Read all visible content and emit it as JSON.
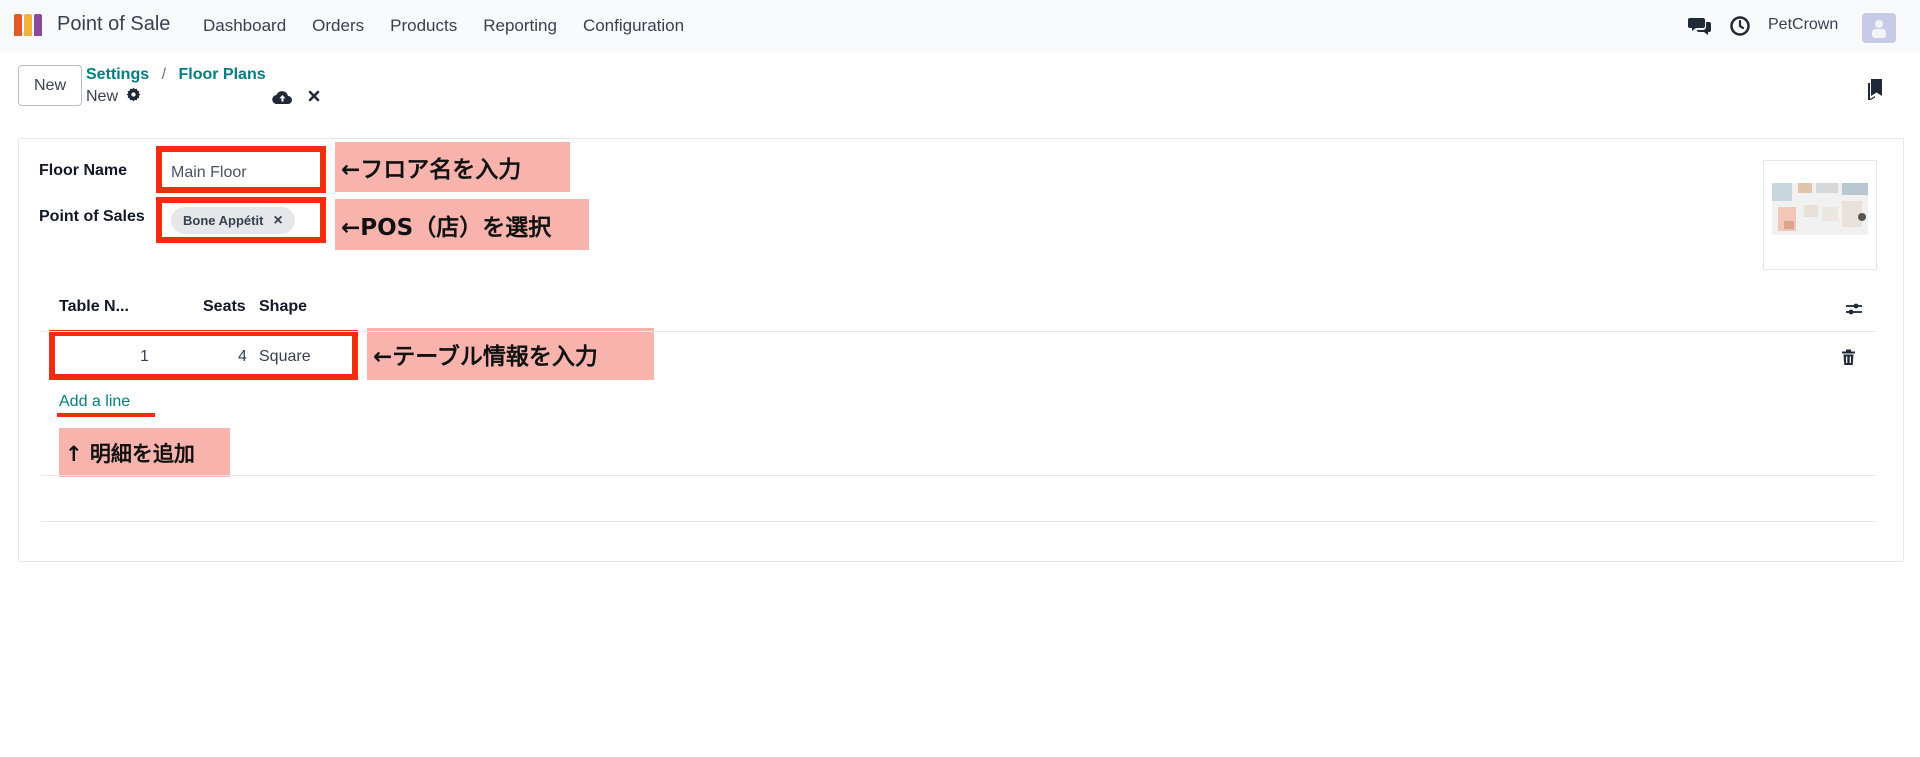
{
  "app": {
    "name": "Point of Sale",
    "logo_colors": [
      "#e05b2a",
      "#f2b23c",
      "#8c4a9c"
    ]
  },
  "navbar": {
    "menu": [
      "Dashboard",
      "Orders",
      "Products",
      "Reporting",
      "Configuration"
    ],
    "icons": [
      "chat-icon",
      "clock-icon"
    ],
    "company": "PetCrown"
  },
  "control_panel": {
    "new_label": "New",
    "breadcrumb": [
      "Settings",
      "Floor Plans"
    ],
    "breadcrumb_sep": "/",
    "record_title": "New",
    "icons": [
      "gear-icon",
      "cloud-upload-icon",
      "close-icon",
      "bookmark-icon"
    ]
  },
  "form": {
    "floor_name_label": "Floor Name",
    "floor_name_value": "Main Floor",
    "pos_label": "Point of Sales",
    "pos_tag": "Bone Appétit",
    "pos_tag_remove": "×"
  },
  "table_list": {
    "columns": [
      "Table N...",
      "Seats",
      "Shape"
    ],
    "rows": [
      {
        "table_number": "1",
        "seats": "4",
        "shape": "Square"
      }
    ],
    "add_line_label": "Add a line",
    "icons": [
      "column-settings-icon",
      "trash-icon"
    ]
  },
  "annotations": {
    "floor_name": "←フロア名を入力",
    "pos": "←POS（店）を選択",
    "table_info": "←テーブル情報を入力",
    "add_line": "↑ 明細を追加",
    "color": "#f22c0e",
    "label_bg": "#f8b3ac"
  },
  "colors": {
    "accent": "#017e84",
    "navbar_bg": "#f9fafb"
  }
}
